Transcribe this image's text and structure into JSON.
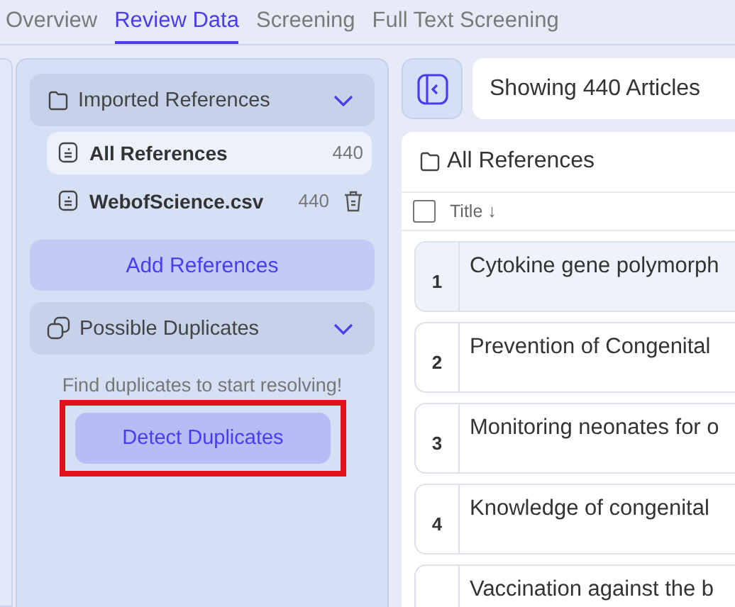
{
  "tabs": [
    {
      "label": "Overview",
      "selected": false
    },
    {
      "label": "Review Data",
      "selected": true
    },
    {
      "label": "Screening",
      "selected": false
    },
    {
      "label": "Full Text Screening",
      "selected": false
    }
  ],
  "sidebar": {
    "imported": {
      "title": "Imported References",
      "expanded": true,
      "items": [
        {
          "label": "All References",
          "count": "440",
          "selected": true,
          "deletable": false
        },
        {
          "label": "WebofScience.csv",
          "count": "440",
          "selected": false,
          "deletable": true
        }
      ]
    },
    "add_button": "Add References",
    "duplicates": {
      "title": "Possible Duplicates",
      "expanded": true,
      "hint": "Find duplicates to start resolving!",
      "button": "Detect Duplicates",
      "highlighted": true
    }
  },
  "toolbar": {
    "showing": "Showing 440 Articles"
  },
  "table": {
    "title": "All References",
    "columns": [
      {
        "label": "Title",
        "sort_icon": "↓"
      }
    ],
    "select_all_checked": false,
    "rows": [
      {
        "number": "1",
        "title": "Cytokine gene polymorph",
        "selected": true
      },
      {
        "number": "2",
        "title": "Prevention of Congenital",
        "selected": false
      },
      {
        "number": "3",
        "title": "Monitoring neonates for o",
        "selected": false
      },
      {
        "number": "4",
        "title": "Knowledge of congenital",
        "selected": false
      },
      {
        "number": "",
        "title": "Vaccination against the b",
        "selected": false
      }
    ]
  }
}
